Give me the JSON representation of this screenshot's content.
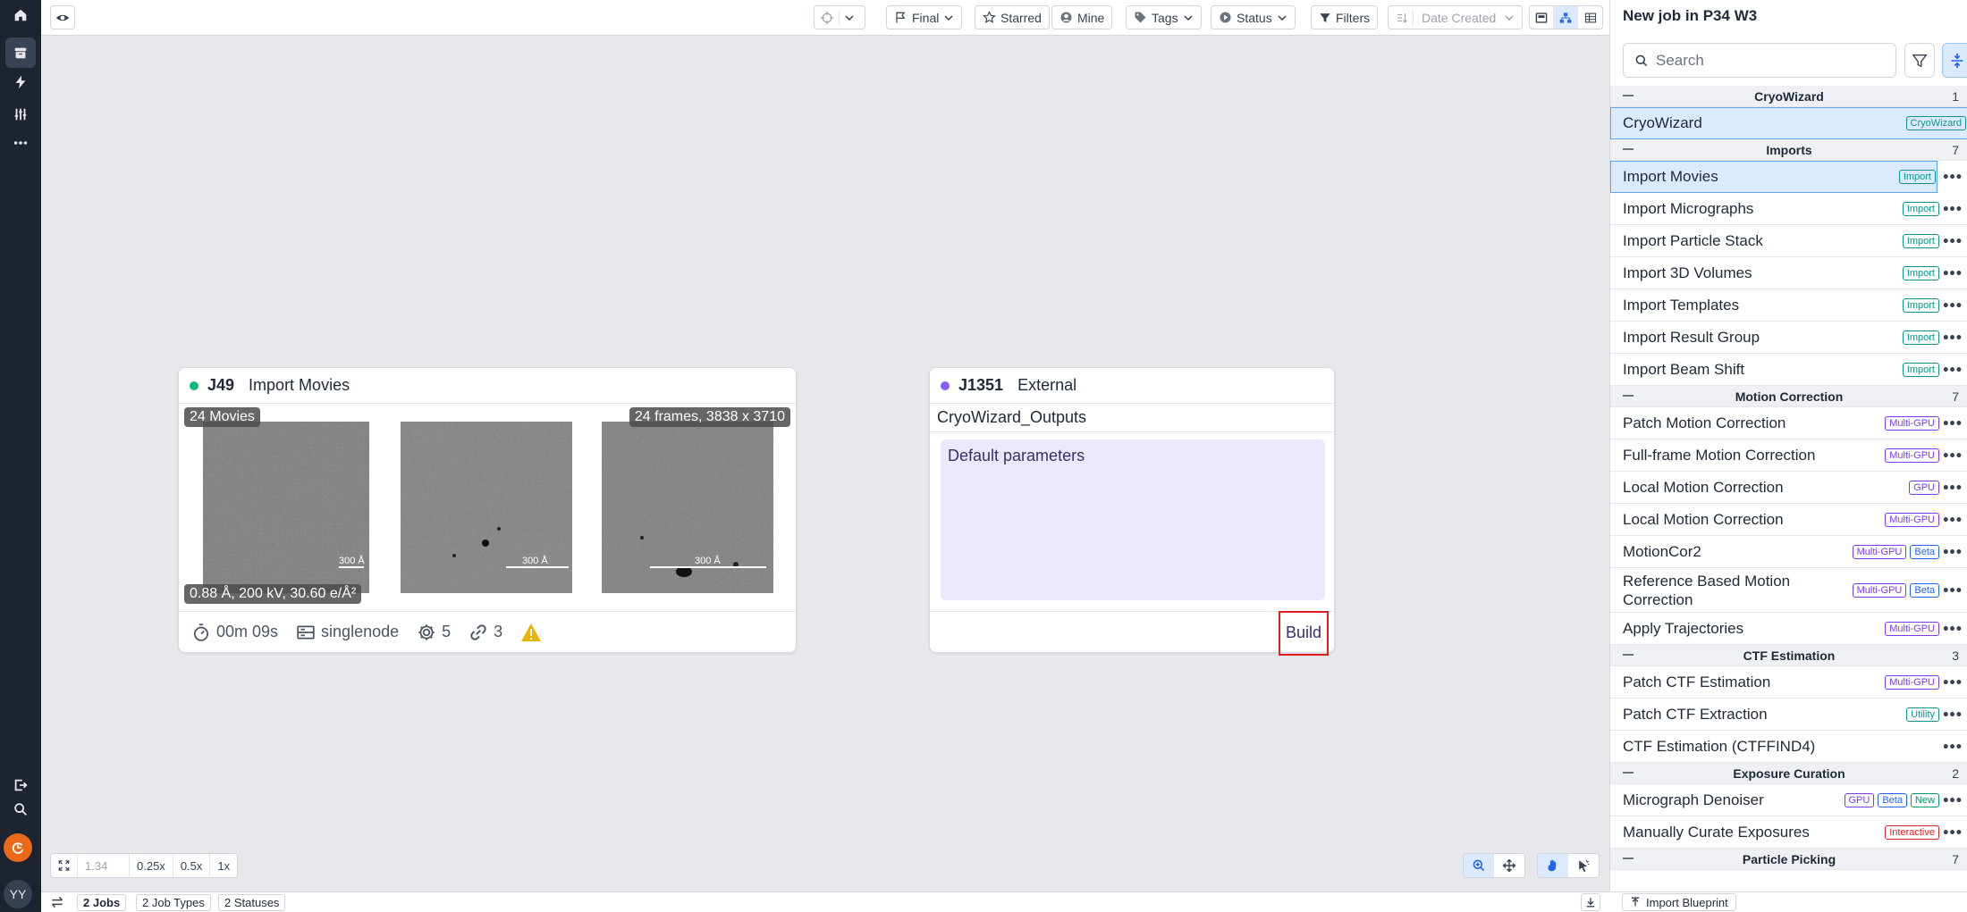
{
  "toolbar": {
    "filters": [
      {
        "label": "Final",
        "icon": "flag-icon",
        "dropdown": true
      },
      {
        "label": "Starred",
        "icon": "star-icon",
        "dropdown": false
      },
      {
        "label": "Mine",
        "icon": "user-icon",
        "dropdown": false
      },
      {
        "label": "Tags",
        "icon": "tag-icon",
        "dropdown": true
      },
      {
        "label": "Status",
        "icon": "play-circle-icon",
        "dropdown": true
      }
    ],
    "filters_button": "Filters",
    "sort_label": "Date Created"
  },
  "cards": {
    "j49": {
      "id": "J49",
      "type": "Import Movies",
      "status_color": "#10b981",
      "badge_count": "24 Movies",
      "badge_frames": "24 frames, 3838 x 3710",
      "badge_params": "0.88 Å, 200 kV, 30.60 e/Å²",
      "scale_label": "300 Å",
      "time": "00m 09s",
      "lane": "singlenode",
      "params": "5",
      "links": "3"
    },
    "j1351": {
      "id": "J1351",
      "type": "External",
      "status_color": "#8b5cf6",
      "title": "CryoWizard_Outputs",
      "params_text": "Default parameters",
      "build_label": "Build"
    }
  },
  "canvas": {
    "zoom_value": "1.34",
    "zoom_presets": [
      "0.25x",
      "0.5x",
      "1x"
    ]
  },
  "statusbar": {
    "chips": [
      "2 Jobs",
      "2 Job Types",
      "2 Statuses"
    ]
  },
  "right_panel": {
    "title": "New job in P34 W3",
    "search_placeholder": "Search",
    "sections": [
      {
        "name": "CryoWizard",
        "count": "1",
        "items": [
          {
            "label": "CryoWizard",
            "tags": [
              {
                "t": "CryoWizard",
                "c": "#0d9488"
              }
            ],
            "selected": true,
            "more": false
          }
        ]
      },
      {
        "name": "Imports",
        "count": "7",
        "items": [
          {
            "label": "Import Movies",
            "tags": [
              {
                "t": "Import",
                "c": "#0d9488"
              }
            ],
            "selected": true,
            "more": true
          },
          {
            "label": "Import Micrographs",
            "tags": [
              {
                "t": "Import",
                "c": "#0d9488"
              }
            ],
            "more": true
          },
          {
            "label": "Import Particle Stack",
            "tags": [
              {
                "t": "Import",
                "c": "#0d9488"
              }
            ],
            "more": true
          },
          {
            "label": "Import 3D Volumes",
            "tags": [
              {
                "t": "Import",
                "c": "#0d9488"
              }
            ],
            "more": true
          },
          {
            "label": "Import Templates",
            "tags": [
              {
                "t": "Import",
                "c": "#0d9488"
              }
            ],
            "more": true
          },
          {
            "label": "Import Result Group",
            "tags": [
              {
                "t": "Import",
                "c": "#0d9488"
              }
            ],
            "more": true
          },
          {
            "label": "Import Beam Shift",
            "tags": [
              {
                "t": "Import",
                "c": "#0d9488"
              }
            ],
            "more": true
          }
        ]
      },
      {
        "name": "Motion Correction",
        "count": "7",
        "items": [
          {
            "label": "Patch Motion Correction",
            "tags": [
              {
                "t": "Multi-GPU",
                "c": "#7c3aed"
              }
            ],
            "more": true
          },
          {
            "label": "Full-frame Motion Correction",
            "tags": [
              {
                "t": "Multi-GPU",
                "c": "#7c3aed"
              }
            ],
            "more": true
          },
          {
            "label": "Local Motion Correction",
            "tags": [
              {
                "t": "GPU",
                "c": "#7c3aed"
              }
            ],
            "more": true
          },
          {
            "label": "Local Motion Correction",
            "tags": [
              {
                "t": "Multi-GPU",
                "c": "#7c3aed"
              }
            ],
            "more": true
          },
          {
            "label": "MotionCor2",
            "tags": [
              {
                "t": "Multi-GPU",
                "c": "#7c3aed"
              },
              {
                "t": "Beta",
                "c": "#2563eb"
              }
            ],
            "more": true
          },
          {
            "label": "Reference Based Motion Correction",
            "tags": [
              {
                "t": "Multi-GPU",
                "c": "#7c3aed"
              },
              {
                "t": "Beta",
                "c": "#2563eb"
              }
            ],
            "more": true,
            "tall": true
          },
          {
            "label": "Apply Trajectories",
            "tags": [
              {
                "t": "Multi-GPU",
                "c": "#7c3aed"
              }
            ],
            "more": true
          }
        ]
      },
      {
        "name": "CTF Estimation",
        "count": "3",
        "items": [
          {
            "label": "Patch CTF Estimation",
            "tags": [
              {
                "t": "Multi-GPU",
                "c": "#7c3aed"
              }
            ],
            "more": true
          },
          {
            "label": "Patch CTF Extraction",
            "tags": [
              {
                "t": "Utility",
                "c": "#0d9488"
              }
            ],
            "more": true
          },
          {
            "label": "CTF Estimation (CTFFIND4)",
            "tags": [],
            "more": true
          }
        ]
      },
      {
        "name": "Exposure Curation",
        "count": "2",
        "items": [
          {
            "label": "Micrograph Denoiser",
            "tags": [
              {
                "t": "GPU",
                "c": "#7c3aed"
              },
              {
                "t": "Beta",
                "c": "#2563eb"
              },
              {
                "t": "New",
                "c": "#059669"
              }
            ],
            "more": true
          },
          {
            "label": "Manually Curate Exposures",
            "tags": [
              {
                "t": "Interactive",
                "c": "#dc2626"
              }
            ],
            "more": true
          }
        ]
      },
      {
        "name": "Particle Picking",
        "count": "7",
        "items": []
      }
    ],
    "blueprint_label": "Import Blueprint"
  }
}
